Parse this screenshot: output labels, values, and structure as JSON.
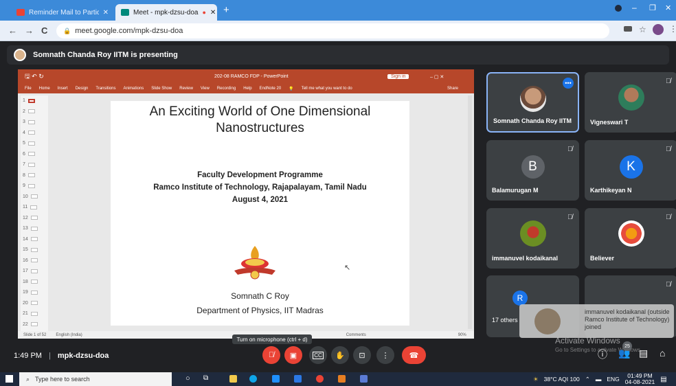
{
  "browser": {
    "tabs": [
      {
        "label": "Reminder Mail to Participate the",
        "active": false
      },
      {
        "label": "Meet - mpk-dzsu-doa",
        "active": true
      }
    ],
    "url": "meet.google.com/mpk-dzsu-doa"
  },
  "meet": {
    "presenting_banner": "Somnath Chanda Roy IITM is presenting",
    "time": "1:49 PM",
    "meeting_code": "mpk-dzsu-doa",
    "tooltip": "Turn on microphone (ctrl + d)",
    "people_count": "25",
    "notification": "immanuvel kodaikanal (outside Ramco Institute of Technology) joined"
  },
  "powerpoint": {
    "file_title": "202-08 RAMCO FDP - PowerPoint",
    "sign_in": "Sign in",
    "ribbon_tabs": [
      "File",
      "Home",
      "Insert",
      "Design",
      "Transitions",
      "Animations",
      "Slide Show",
      "Review",
      "View",
      "Recording",
      "Help",
      "EndNote 20"
    ],
    "tell_me": "Tell me what you want to do",
    "share": "Share",
    "status_slide": "Slide 1 of 52",
    "status_lang": "English (India)",
    "status_comments": "Comments",
    "zoom": "90%",
    "thumb_numbers": [
      "1",
      "2",
      "3",
      "4",
      "5",
      "6",
      "7",
      "8",
      "9",
      "10",
      "11",
      "12",
      "13",
      "14",
      "15",
      "16",
      "17",
      "18",
      "19",
      "20",
      "21",
      "22"
    ]
  },
  "slide": {
    "title_line1": "An Exciting World of One Dimensional",
    "title_line2": "Nanostructures",
    "program": "Faculty Development Programme",
    "institute": "Ramco Institute of Technology, Rajapalayam, Tamil Nadu",
    "date": "August 4, 2021",
    "author": "Somnath C Roy",
    "department": "Department of Physics, IIT Madras"
  },
  "participants": [
    {
      "name": "Somnath Chanda Roy IITM"
    },
    {
      "name": "Vigneswari T"
    },
    {
      "name": "Balamurugan M",
      "initial": "B",
      "color": "#5f6368"
    },
    {
      "name": "Karthikeyan N",
      "initial": "K",
      "color": "#1a73e8"
    },
    {
      "name": "immanuvel kodaikanal"
    },
    {
      "name": "Believer"
    },
    {
      "name": "17 others",
      "initial": "R",
      "color": "#1a73e8"
    }
  ],
  "windows_watermark": {
    "line1": "Activate Windows",
    "line2": "Go to Settings to activate Windows."
  },
  "taskbar": {
    "search_placeholder": "Type here to search",
    "weather": "38°C  AQI 100",
    "lang": "ENG",
    "clock_time": "01:49 PM",
    "clock_date": "04-08-2021"
  }
}
